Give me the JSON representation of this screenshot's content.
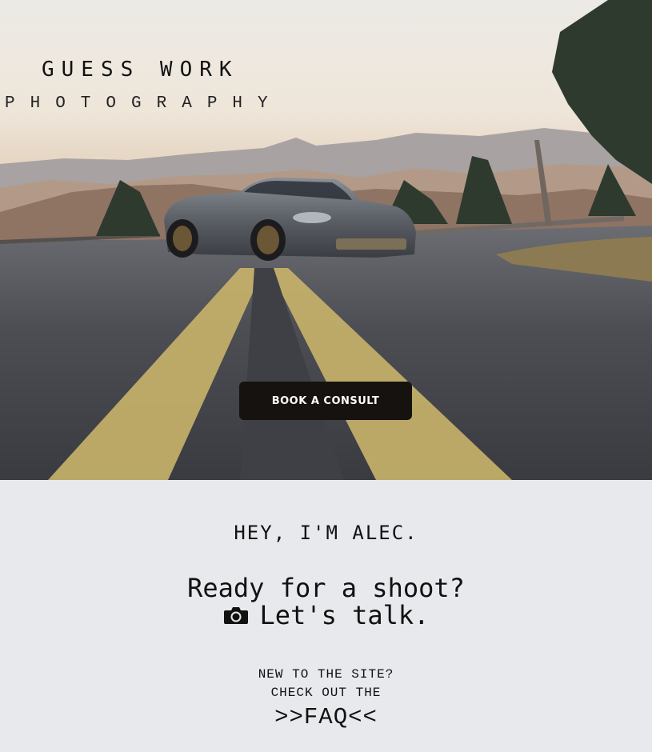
{
  "brand": {
    "title": "GUESS WORK",
    "subtitle": "PHOTOGRAPHY"
  },
  "hero": {
    "cta_label": "BOOK A CONSULT"
  },
  "intro": {
    "greeting": "HEY, I'M ALEC.",
    "headline_line1": "Ready for a shoot?",
    "headline_line2": "Let's talk.",
    "camera_icon": "camera-icon",
    "new_line1": "NEW TO THE SITE?",
    "new_line2": "CHECK OUT THE",
    "faq_link": ">>FAQ<<"
  },
  "colors": {
    "page_bg": "#e7e9ec",
    "button_bg": "#15120f",
    "road_line": "#c9b46a"
  }
}
